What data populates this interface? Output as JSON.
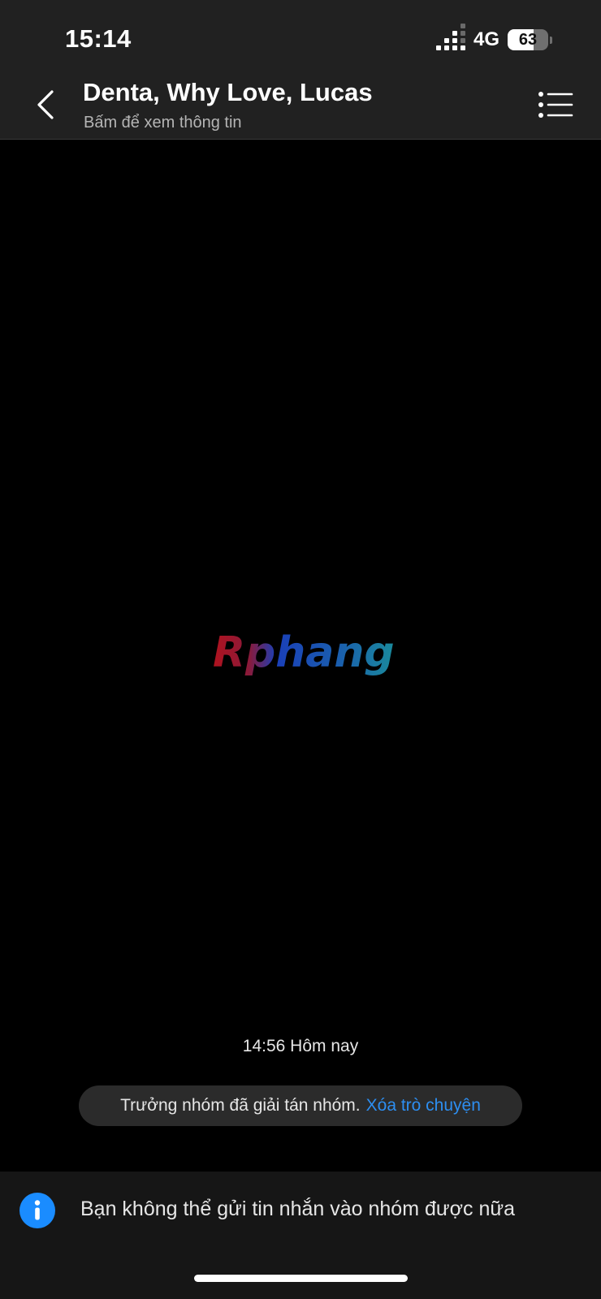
{
  "status_bar": {
    "time": "15:14",
    "network": "4G",
    "battery": "63",
    "battery_level": 0.63
  },
  "header": {
    "title": "Denta, Why Love, Lucas",
    "subtitle": "Bấm để xem thông tin",
    "back_icon": "chevron-left-icon",
    "menu_icon": "list-menu-icon"
  },
  "chat": {
    "watermark": "Rphang",
    "timestamp": "14:56 Hôm nay",
    "notice": {
      "text": "Trưởng nhóm đã giải tán nhóm.",
      "link": "Xóa trò chuyện"
    }
  },
  "bottom_bar": {
    "icon": "info-icon",
    "text": "Bạn không thể gửi tin nhắn vào nhóm được nữa"
  },
  "colors": {
    "accent": "#1a8cff",
    "link": "#2d8ef0",
    "header_bg": "#212121",
    "chat_bg": "#000000"
  }
}
